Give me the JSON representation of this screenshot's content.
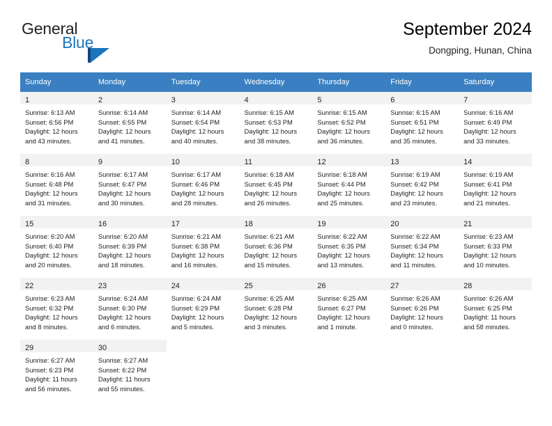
{
  "brand": {
    "name_part1": "General",
    "name_part2": "Blue",
    "logo_icon": "blue-triangle-logo"
  },
  "header": {
    "title": "September 2024",
    "location": "Dongping, Hunan, China"
  },
  "calendar": {
    "weekday_headers": [
      "Sunday",
      "Monday",
      "Tuesday",
      "Wednesday",
      "Thursday",
      "Friday",
      "Saturday"
    ],
    "header_bg": "#3a7fc1",
    "daynum_bg": "#f2f2f2",
    "weeks": [
      [
        {
          "day": "1",
          "sunrise": "Sunrise: 6:13 AM",
          "sunset": "Sunset: 6:56 PM",
          "daylight_line1": "Daylight: 12 hours",
          "daylight_line2": "and 43 minutes."
        },
        {
          "day": "2",
          "sunrise": "Sunrise: 6:14 AM",
          "sunset": "Sunset: 6:55 PM",
          "daylight_line1": "Daylight: 12 hours",
          "daylight_line2": "and 41 minutes."
        },
        {
          "day": "3",
          "sunrise": "Sunrise: 6:14 AM",
          "sunset": "Sunset: 6:54 PM",
          "daylight_line1": "Daylight: 12 hours",
          "daylight_line2": "and 40 minutes."
        },
        {
          "day": "4",
          "sunrise": "Sunrise: 6:15 AM",
          "sunset": "Sunset: 6:53 PM",
          "daylight_line1": "Daylight: 12 hours",
          "daylight_line2": "and 38 minutes."
        },
        {
          "day": "5",
          "sunrise": "Sunrise: 6:15 AM",
          "sunset": "Sunset: 6:52 PM",
          "daylight_line1": "Daylight: 12 hours",
          "daylight_line2": "and 36 minutes."
        },
        {
          "day": "6",
          "sunrise": "Sunrise: 6:15 AM",
          "sunset": "Sunset: 6:51 PM",
          "daylight_line1": "Daylight: 12 hours",
          "daylight_line2": "and 35 minutes."
        },
        {
          "day": "7",
          "sunrise": "Sunrise: 6:16 AM",
          "sunset": "Sunset: 6:49 PM",
          "daylight_line1": "Daylight: 12 hours",
          "daylight_line2": "and 33 minutes."
        }
      ],
      [
        {
          "day": "8",
          "sunrise": "Sunrise: 6:16 AM",
          "sunset": "Sunset: 6:48 PM",
          "daylight_line1": "Daylight: 12 hours",
          "daylight_line2": "and 31 minutes."
        },
        {
          "day": "9",
          "sunrise": "Sunrise: 6:17 AM",
          "sunset": "Sunset: 6:47 PM",
          "daylight_line1": "Daylight: 12 hours",
          "daylight_line2": "and 30 minutes."
        },
        {
          "day": "10",
          "sunrise": "Sunrise: 6:17 AM",
          "sunset": "Sunset: 6:46 PM",
          "daylight_line1": "Daylight: 12 hours",
          "daylight_line2": "and 28 minutes."
        },
        {
          "day": "11",
          "sunrise": "Sunrise: 6:18 AM",
          "sunset": "Sunset: 6:45 PM",
          "daylight_line1": "Daylight: 12 hours",
          "daylight_line2": "and 26 minutes."
        },
        {
          "day": "12",
          "sunrise": "Sunrise: 6:18 AM",
          "sunset": "Sunset: 6:44 PM",
          "daylight_line1": "Daylight: 12 hours",
          "daylight_line2": "and 25 minutes."
        },
        {
          "day": "13",
          "sunrise": "Sunrise: 6:19 AM",
          "sunset": "Sunset: 6:42 PM",
          "daylight_line1": "Daylight: 12 hours",
          "daylight_line2": "and 23 minutes."
        },
        {
          "day": "14",
          "sunrise": "Sunrise: 6:19 AM",
          "sunset": "Sunset: 6:41 PM",
          "daylight_line1": "Daylight: 12 hours",
          "daylight_line2": "and 21 minutes."
        }
      ],
      [
        {
          "day": "15",
          "sunrise": "Sunrise: 6:20 AM",
          "sunset": "Sunset: 6:40 PM",
          "daylight_line1": "Daylight: 12 hours",
          "daylight_line2": "and 20 minutes."
        },
        {
          "day": "16",
          "sunrise": "Sunrise: 6:20 AM",
          "sunset": "Sunset: 6:39 PM",
          "daylight_line1": "Daylight: 12 hours",
          "daylight_line2": "and 18 minutes."
        },
        {
          "day": "17",
          "sunrise": "Sunrise: 6:21 AM",
          "sunset": "Sunset: 6:38 PM",
          "daylight_line1": "Daylight: 12 hours",
          "daylight_line2": "and 16 minutes."
        },
        {
          "day": "18",
          "sunrise": "Sunrise: 6:21 AM",
          "sunset": "Sunset: 6:36 PM",
          "daylight_line1": "Daylight: 12 hours",
          "daylight_line2": "and 15 minutes."
        },
        {
          "day": "19",
          "sunrise": "Sunrise: 6:22 AM",
          "sunset": "Sunset: 6:35 PM",
          "daylight_line1": "Daylight: 12 hours",
          "daylight_line2": "and 13 minutes."
        },
        {
          "day": "20",
          "sunrise": "Sunrise: 6:22 AM",
          "sunset": "Sunset: 6:34 PM",
          "daylight_line1": "Daylight: 12 hours",
          "daylight_line2": "and 11 minutes."
        },
        {
          "day": "21",
          "sunrise": "Sunrise: 6:23 AM",
          "sunset": "Sunset: 6:33 PM",
          "daylight_line1": "Daylight: 12 hours",
          "daylight_line2": "and 10 minutes."
        }
      ],
      [
        {
          "day": "22",
          "sunrise": "Sunrise: 6:23 AM",
          "sunset": "Sunset: 6:32 PM",
          "daylight_line1": "Daylight: 12 hours",
          "daylight_line2": "and 8 minutes."
        },
        {
          "day": "23",
          "sunrise": "Sunrise: 6:24 AM",
          "sunset": "Sunset: 6:30 PM",
          "daylight_line1": "Daylight: 12 hours",
          "daylight_line2": "and 6 minutes."
        },
        {
          "day": "24",
          "sunrise": "Sunrise: 6:24 AM",
          "sunset": "Sunset: 6:29 PM",
          "daylight_line1": "Daylight: 12 hours",
          "daylight_line2": "and 5 minutes."
        },
        {
          "day": "25",
          "sunrise": "Sunrise: 6:25 AM",
          "sunset": "Sunset: 6:28 PM",
          "daylight_line1": "Daylight: 12 hours",
          "daylight_line2": "and 3 minutes."
        },
        {
          "day": "26",
          "sunrise": "Sunrise: 6:25 AM",
          "sunset": "Sunset: 6:27 PM",
          "daylight_line1": "Daylight: 12 hours",
          "daylight_line2": "and 1 minute."
        },
        {
          "day": "27",
          "sunrise": "Sunrise: 6:26 AM",
          "sunset": "Sunset: 6:26 PM",
          "daylight_line1": "Daylight: 12 hours",
          "daylight_line2": "and 0 minutes."
        },
        {
          "day": "28",
          "sunrise": "Sunrise: 6:26 AM",
          "sunset": "Sunset: 6:25 PM",
          "daylight_line1": "Daylight: 11 hours",
          "daylight_line2": "and 58 minutes."
        }
      ],
      [
        {
          "day": "29",
          "sunrise": "Sunrise: 6:27 AM",
          "sunset": "Sunset: 6:23 PM",
          "daylight_line1": "Daylight: 11 hours",
          "daylight_line2": "and 56 minutes."
        },
        {
          "day": "30",
          "sunrise": "Sunrise: 6:27 AM",
          "sunset": "Sunset: 6:22 PM",
          "daylight_line1": "Daylight: 11 hours",
          "daylight_line2": "and 55 minutes."
        },
        {
          "day": "",
          "sunrise": "",
          "sunset": "",
          "daylight_line1": "",
          "daylight_line2": ""
        },
        {
          "day": "",
          "sunrise": "",
          "sunset": "",
          "daylight_line1": "",
          "daylight_line2": ""
        },
        {
          "day": "",
          "sunrise": "",
          "sunset": "",
          "daylight_line1": "",
          "daylight_line2": ""
        },
        {
          "day": "",
          "sunrise": "",
          "sunset": "",
          "daylight_line1": "",
          "daylight_line2": ""
        },
        {
          "day": "",
          "sunrise": "",
          "sunset": "",
          "daylight_line1": "",
          "daylight_line2": ""
        }
      ]
    ]
  }
}
